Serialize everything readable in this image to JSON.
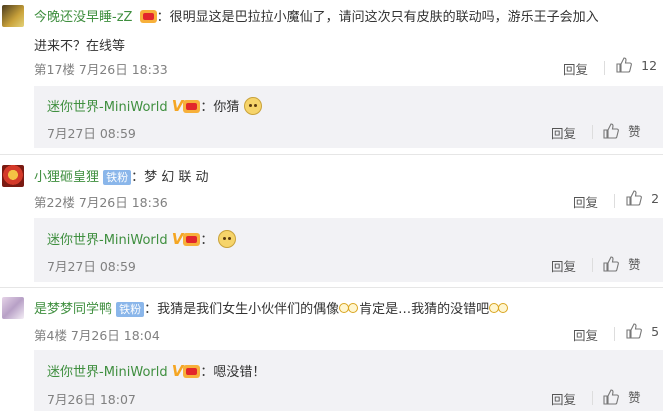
{
  "comments": [
    {
      "user": "今晚还没早睡-zZ",
      "text_line1": "：很明显这是巴拉拉小魔仙了，请问这次只有皮肤的联动吗，游乐王子会加入",
      "text_line2": "进来不？在线等",
      "meta": "第17楼 7月26日 18:33",
      "reply_label": "回复",
      "like_count": "12",
      "reply": {
        "user": "迷你世界-MiniWorld",
        "v": "V",
        "text": "：你猜",
        "time": "7月27日 08:59",
        "reply_label": "回复",
        "like_label": "赞"
      }
    },
    {
      "user": "小狸砸皇狸",
      "badge": "铁粉",
      "text": "：梦 幻 联 动",
      "meta": "第22楼 7月26日 18:36",
      "reply_label": "回复",
      "like_count": "2",
      "reply": {
        "user": "迷你世界-MiniWorld",
        "v": "V",
        "text": "：",
        "time": "7月27日 08:59",
        "reply_label": "回复",
        "like_label": "赞"
      }
    },
    {
      "user": "是梦梦同学鸭",
      "badge": "铁粉",
      "text_a": "：我猜是我们女生小伙伴们的偶像",
      "text_b": "肯定是…我猜的没错吧",
      "meta": "第4楼 7月26日 18:04",
      "reply_label": "回复",
      "like_count": "5",
      "reply": {
        "user": "迷你世界-MiniWorld",
        "v": "V",
        "text": "：嗯没错！",
        "time": "7月26日 18:07",
        "reply_label": "回复",
        "like_label": "赞"
      }
    }
  ]
}
